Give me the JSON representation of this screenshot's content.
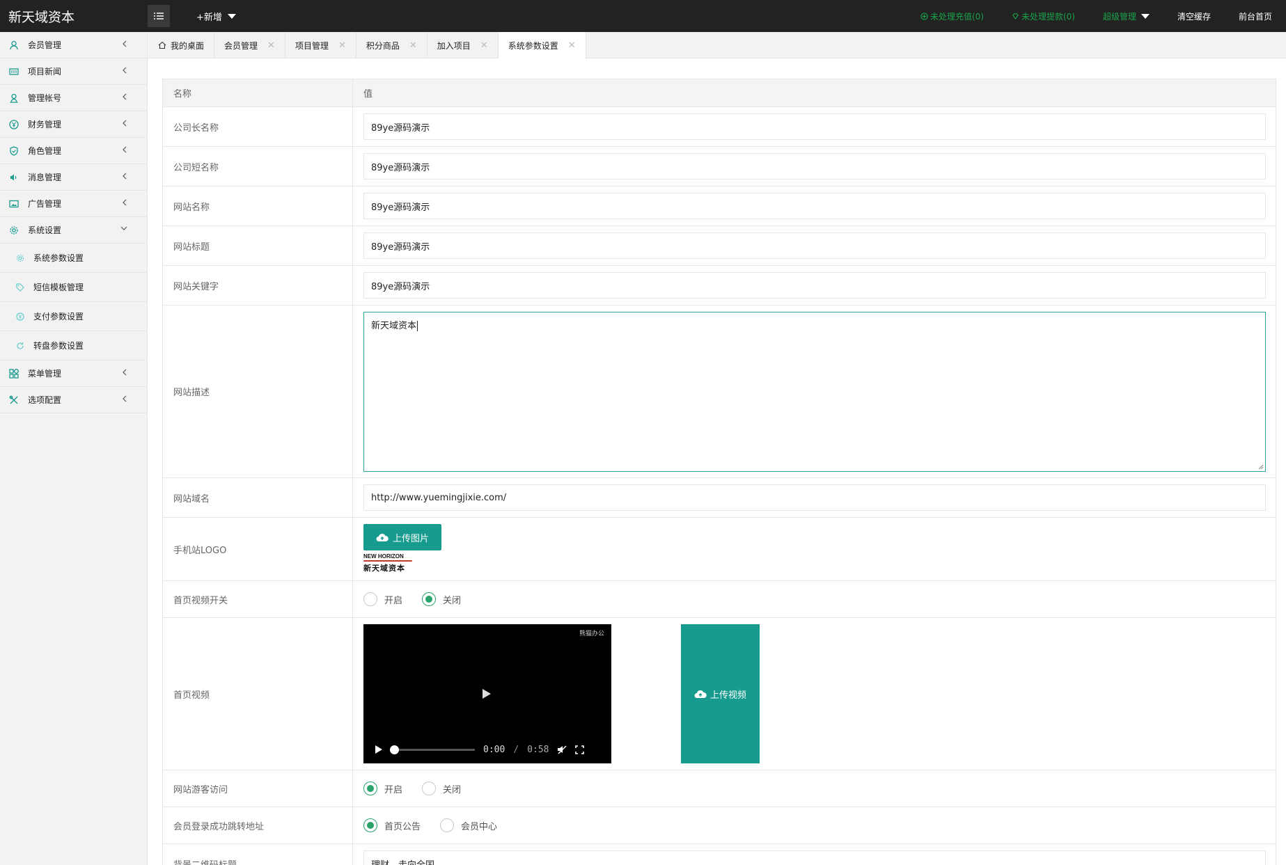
{
  "app": {
    "brand": "新天域资本",
    "new_label": "+新增"
  },
  "topnav": {
    "recharge": "未处理充值(0)",
    "withdraw": "未处理提款(0)",
    "admin": "超级管理",
    "clear_cache": "清空缓存",
    "front_home": "前台首页"
  },
  "sidebar": {
    "items": [
      {
        "label": "会员管理",
        "icon": "user-icon"
      },
      {
        "label": "项目新闻",
        "icon": "news-icon"
      },
      {
        "label": "管理帐号",
        "icon": "account-icon"
      },
      {
        "label": "财务管理",
        "icon": "finance-icon"
      },
      {
        "label": "角色管理",
        "icon": "shield-icon"
      },
      {
        "label": "消息管理",
        "icon": "speaker-icon"
      },
      {
        "label": "广告管理",
        "icon": "image-icon"
      },
      {
        "label": "系统设置",
        "icon": "gear-icon"
      }
    ],
    "subitems": [
      {
        "label": "系统参数设置",
        "icon": "gear-icon"
      },
      {
        "label": "短信模板管理",
        "icon": "tag-icon"
      },
      {
        "label": "支付参数设置",
        "icon": "coin-icon"
      },
      {
        "label": "转盘参数设置",
        "icon": "refresh-icon"
      }
    ],
    "items_after": [
      {
        "label": "菜单管理",
        "icon": "grid-icon"
      },
      {
        "label": "选项配置",
        "icon": "tools-icon"
      }
    ]
  },
  "tabs": [
    {
      "label": "我的桌面"
    },
    {
      "label": "会员管理"
    },
    {
      "label": "项目管理"
    },
    {
      "label": "积分商品"
    },
    {
      "label": "加入项目"
    },
    {
      "label": "系统参数设置"
    }
  ],
  "table": {
    "header_name": "名称",
    "header_value": "值",
    "rows": {
      "company_long": {
        "label": "公司长名称",
        "value": "89ye源码演示"
      },
      "company_short": {
        "label": "公司短名称",
        "value": "89ye源码演示"
      },
      "site_name": {
        "label": "网站名称",
        "value": "89ye源码演示"
      },
      "site_title": {
        "label": "网站标题",
        "value": "89ye源码演示"
      },
      "site_keywords": {
        "label": "网站关键字",
        "value": "89ye源码演示"
      },
      "site_desc": {
        "label": "网站描述",
        "value": "新天域资本"
      },
      "site_domain": {
        "label": "网站域名",
        "value": "http://www.yuemingjixie.com/"
      },
      "mobile_logo": {
        "label": "手机站LOGO",
        "button": "上传图片",
        "logo_en": "NEW HORIZON",
        "logo_cn": "新天域资本"
      },
      "home_video_switch": {
        "label": "首页视频开关",
        "opt1": "开启",
        "opt2": "关闭",
        "selected": "关闭"
      },
      "home_video": {
        "label": "首页视频",
        "watermark": "熊猫办公",
        "current_time": "0:00",
        "sep": "/",
        "duration": "0:58",
        "progress": 0,
        "upload": "上传视频"
      },
      "guest_access": {
        "label": "网站游客访问",
        "opt1": "开启",
        "opt2": "关闭",
        "selected": "开启"
      },
      "login_redirect": {
        "label": "会员登录成功跳转地址",
        "opt1": "首页公告",
        "opt2": "会员中心",
        "selected": "首页公告"
      },
      "bg_qr_title": {
        "label": "背景二维码标题",
        "value": "理财，走向全国"
      }
    }
  },
  "colors": {
    "teal": "#169b8e",
    "green": "#1aa34a",
    "topbar": "#222222",
    "sidebar": "#f2f2f2"
  }
}
